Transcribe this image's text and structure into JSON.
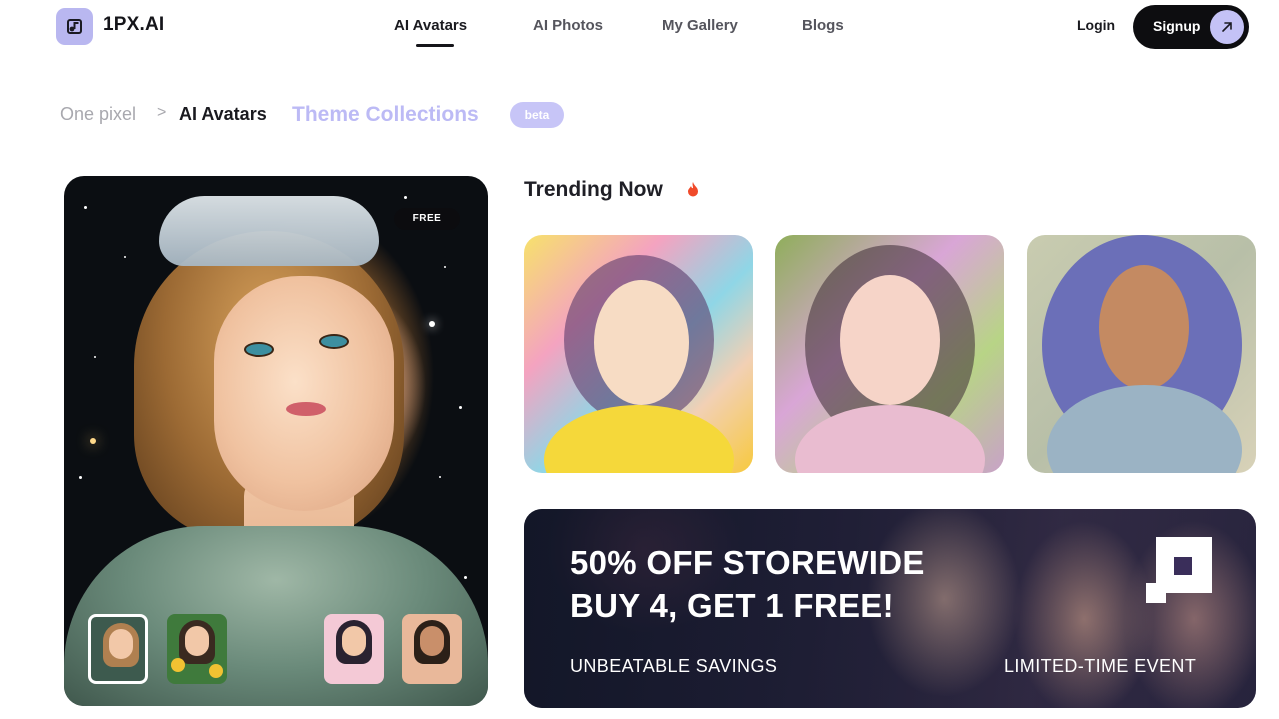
{
  "brand": {
    "name": "1PX.AI",
    "logo_icon": "music-note-logo-icon",
    "accent": "#b9b7f0"
  },
  "nav": {
    "items": [
      {
        "label": "AI Avatars",
        "active": true
      },
      {
        "label": "AI Photos",
        "active": false
      },
      {
        "label": "My Gallery",
        "active": false
      },
      {
        "label": "Blogs",
        "active": false
      }
    ],
    "login_label": "Login",
    "signup_label": "Signup"
  },
  "breadcrumb": {
    "home": "One pixel",
    "separator": ">",
    "current": "AI Avatars",
    "collection": "Theme Collections",
    "badge": "beta"
  },
  "hero": {
    "badge": "FREE",
    "thumbnails": [
      {
        "selected": true
      },
      {
        "selected": false
      },
      {
        "selected": false
      },
      {
        "selected": false
      }
    ]
  },
  "trending": {
    "title": "Trending Now",
    "icon": "flame-icon"
  },
  "promo": {
    "line1": "50% OFF STOREWIDE",
    "line2": "BUY 4, GET 1 FREE!",
    "left_caption": "UNBEATABLE SAVINGS",
    "right_caption": "LIMITED-TIME EVENT"
  }
}
